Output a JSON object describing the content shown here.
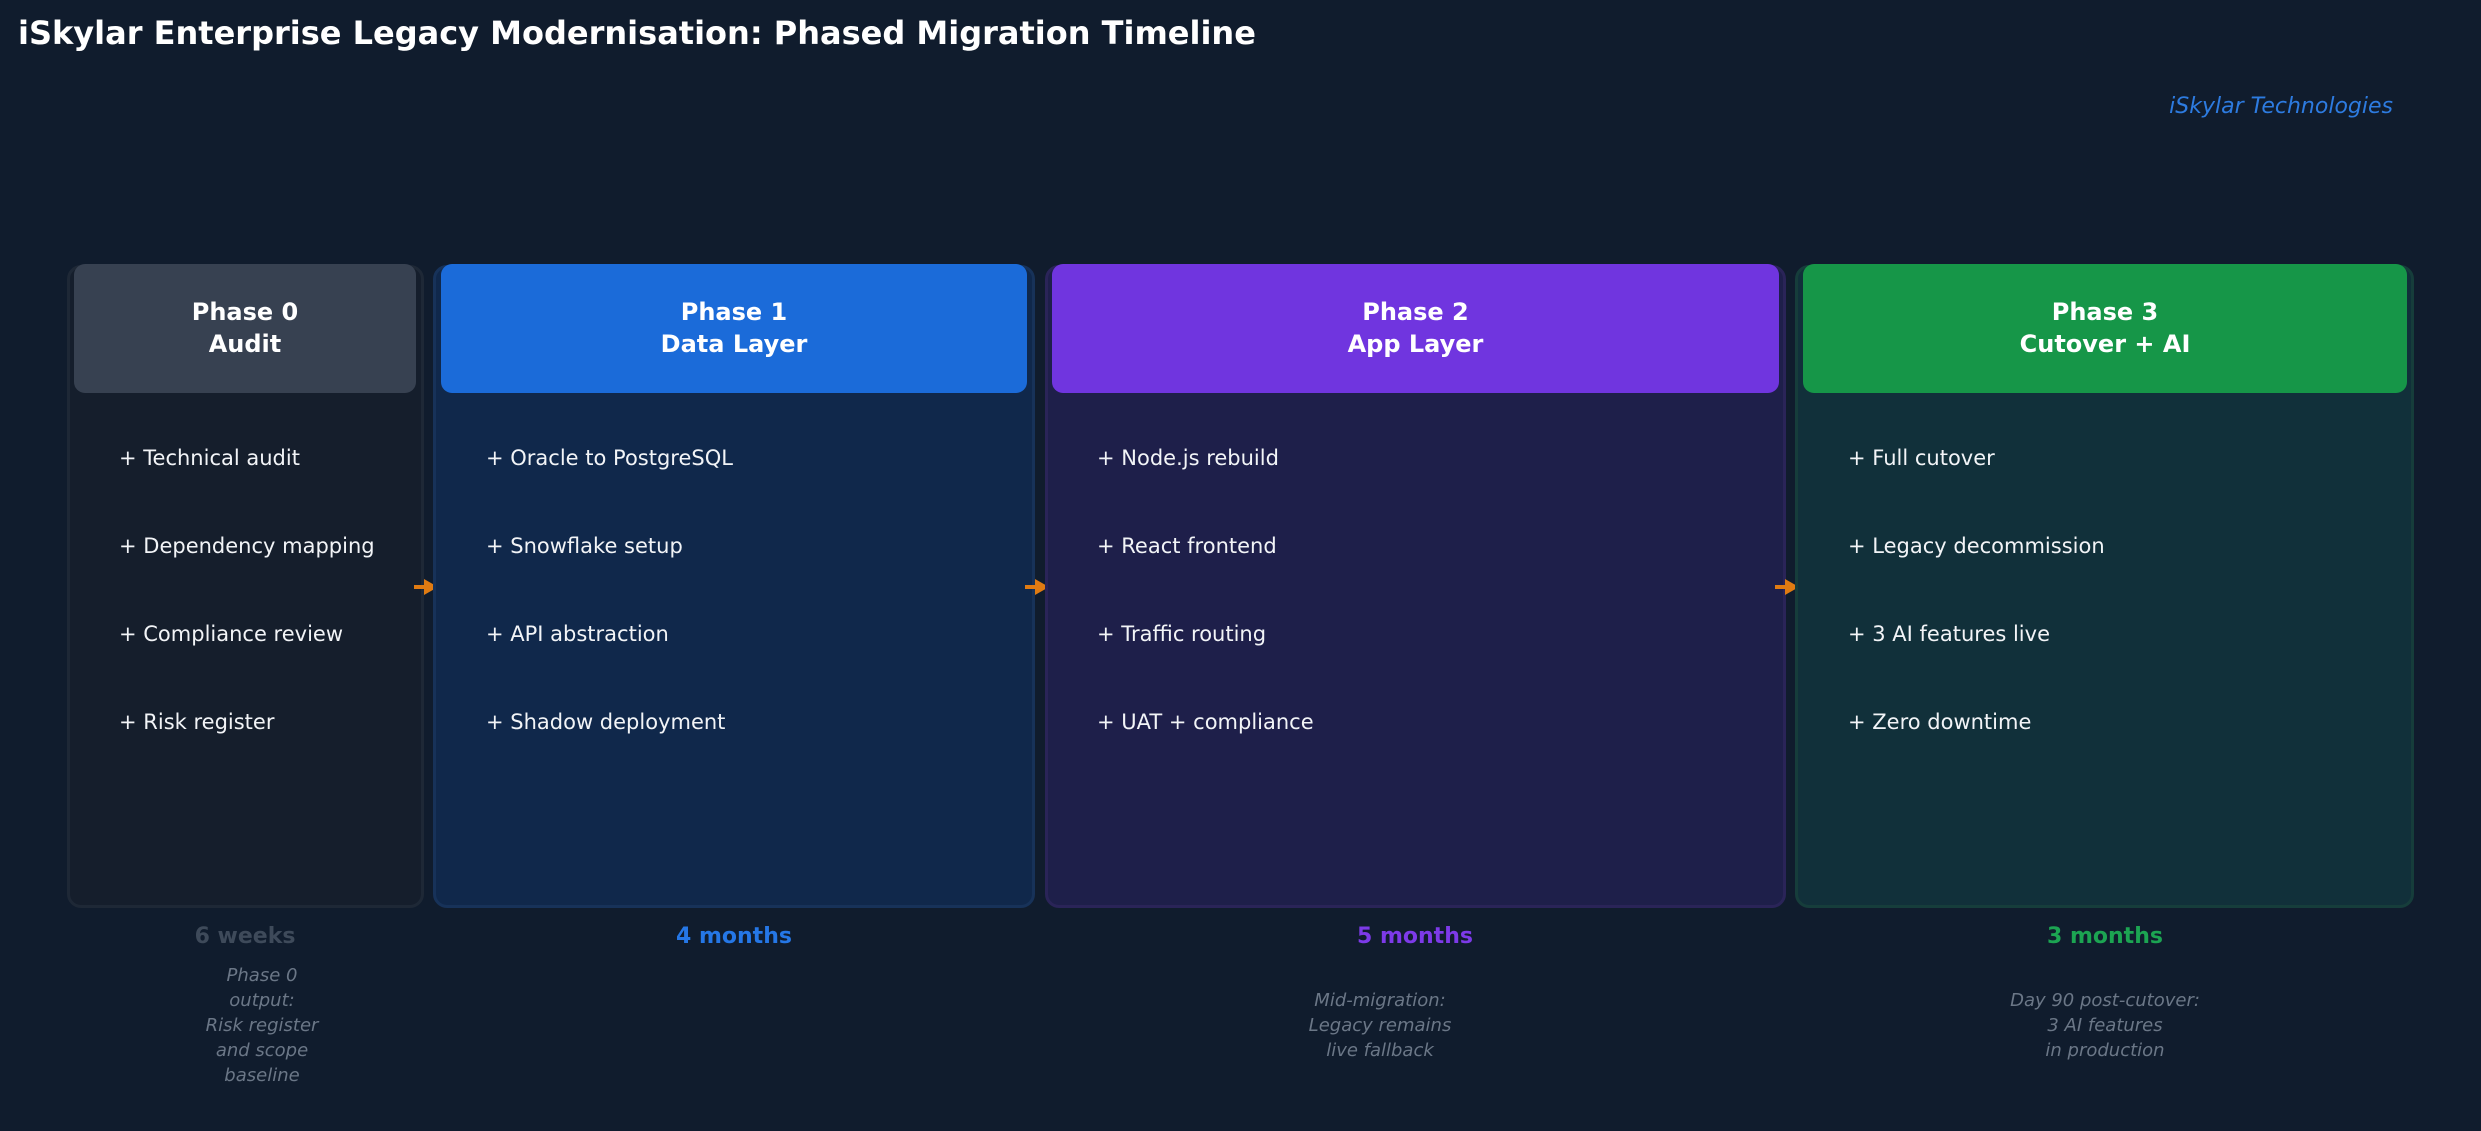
{
  "title": "iSkylar Enterprise Legacy Modernisation: Phased Migration Timeline",
  "brand": "iSkylar Technologies",
  "colors": {
    "background": "#101c2d",
    "arrow": "#e07b12",
    "brand": "#2d7be0"
  },
  "phases": [
    {
      "header_line1": "Phase 0",
      "header_line2": "Audit",
      "color": "#374151",
      "body_bg": "#151e2c",
      "body_border": "#1e2836",
      "items": [
        "+ Technical audit",
        "+ Dependency mapping",
        "+ Compliance review",
        "+ Risk register"
      ],
      "duration": "6 weeks",
      "duration_color": "#3e4a5a",
      "note_lines": [
        "Phase 0",
        "output:",
        "Risk register",
        "and scope",
        "baseline"
      ]
    },
    {
      "header_line1": "Phase 1",
      "header_line2": "Data Layer",
      "color": "#1b6bd9",
      "body_bg": "#10284b",
      "body_border": "#173259",
      "items": [
        "+ Oracle to PostgreSQL",
        "+ Snowflake setup",
        "+ API abstraction",
        "+ Shadow deployment"
      ],
      "duration": "4 months",
      "duration_color": "#2577e6",
      "note_lines": []
    },
    {
      "header_line1": "Phase 2",
      "header_line2": "App Layer",
      "color": "#7035df",
      "body_bg": "#1e1f4a",
      "body_border": "#2a2458",
      "items": [
        "+ Node.js rebuild",
        "+ React frontend",
        "+ Traffic routing",
        "+ UAT + compliance"
      ],
      "duration": "5 months",
      "duration_color": "#7d3ae8",
      "note_lines": [
        "Mid-migration:",
        "Legacy remains",
        "live fallback"
      ]
    },
    {
      "header_line1": "Phase 3",
      "header_line2": "Cutover + AI",
      "color": "#169648",
      "body_bg": "#11303a",
      "body_border": "#163d3b",
      "items": [
        "+ Full cutover",
        "+ Legacy decommission",
        "+ 3 AI features live",
        "+ Zero downtime"
      ],
      "duration": "3 months",
      "duration_color": "#1ca452",
      "note_lines": [
        "Day 90 post-cutover:",
        "3 AI features",
        "in production"
      ]
    }
  ]
}
